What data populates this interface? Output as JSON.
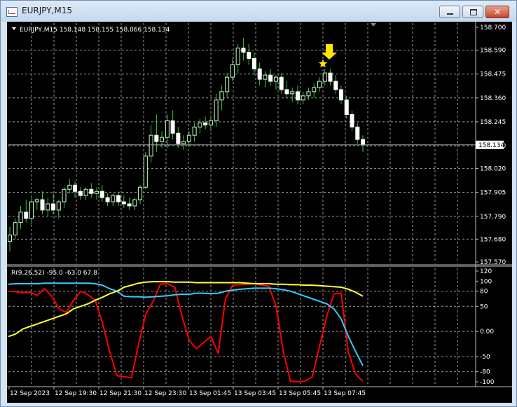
{
  "window": {
    "title": "EURJPY,M15",
    "controls": {
      "minimize": "minimize",
      "maximize": "maximize",
      "close": "close"
    }
  },
  "colors": {
    "background": "#000000",
    "grid": "#9a9a9a",
    "bull_candle": "#ccffcc",
    "bear_candle": "#ffffff",
    "wick": "#33cc33",
    "price_line": "#a0a0a0",
    "red_line": "#ff0000",
    "cyan_line": "#33ccff",
    "yellow_line": "#ffff33",
    "signal": "#ffe600"
  },
  "price_panel": {
    "header": "EURJPY,M15  158.148 158.155 158.066 158.134",
    "current_price": "158.134",
    "y_ticks": [
      "158.700",
      "158.590",
      "158.475",
      "158.360",
      "158.245",
      "158.130",
      "158.020",
      "157.905",
      "157.790",
      "157.680",
      "157.570"
    ],
    "ylim": [
      157.57,
      158.7
    ]
  },
  "indicator_panel": {
    "header": "R(9,26,52) -95.0 -63.0 67.8",
    "y_ticks": [
      "120",
      "100",
      "80",
      "50",
      "0.00",
      "-50",
      "-80",
      "-100"
    ],
    "ylim": [
      -100,
      120
    ]
  },
  "x_axis": {
    "labels": [
      "12 Sep 2023",
      "12 Sep 19:30",
      "12 Sep 21:30",
      "12 Sep 23:30",
      "13 Sep 01:45",
      "13 Sep 03:45",
      "13 Sep 05:45",
      "13 Sep 07:45"
    ]
  },
  "chart_data": [
    {
      "type": "candlestick",
      "symbol": "EURJPY",
      "timeframe": "M15",
      "ohlc_open_high_low_close": [
        [
          157.67,
          157.74,
          157.62,
          157.7
        ],
        [
          157.7,
          157.78,
          157.68,
          157.76
        ],
        [
          157.76,
          157.84,
          157.73,
          157.81
        ],
        [
          157.81,
          157.87,
          157.76,
          157.78
        ],
        [
          157.78,
          157.88,
          157.75,
          157.86
        ],
        [
          157.86,
          157.88,
          157.82,
          157.87
        ],
        [
          157.87,
          157.91,
          157.8,
          157.82
        ],
        [
          157.82,
          157.88,
          157.79,
          157.85
        ],
        [
          157.85,
          157.9,
          157.8,
          157.82
        ],
        [
          157.82,
          157.87,
          157.78,
          157.86
        ],
        [
          157.86,
          157.93,
          157.83,
          157.92
        ],
        [
          157.92,
          157.97,
          157.9,
          157.94
        ],
        [
          157.94,
          157.96,
          157.88,
          157.91
        ],
        [
          157.91,
          157.93,
          157.87,
          157.89
        ],
        [
          157.89,
          157.93,
          157.87,
          157.92
        ],
        [
          157.92,
          157.95,
          157.88,
          157.9
        ],
        [
          157.9,
          157.93,
          157.87,
          157.91
        ],
        [
          157.91,
          157.94,
          157.86,
          157.88
        ],
        [
          157.88,
          157.9,
          157.84,
          157.86
        ],
        [
          157.86,
          157.9,
          157.84,
          157.89
        ],
        [
          157.89,
          157.91,
          157.84,
          157.86
        ],
        [
          157.86,
          157.89,
          157.83,
          157.85
        ],
        [
          157.85,
          157.88,
          157.82,
          157.84
        ],
        [
          157.84,
          157.88,
          157.82,
          157.87
        ],
        [
          157.87,
          157.94,
          157.85,
          157.93
        ],
        [
          157.93,
          158.1,
          157.92,
          158.08
        ],
        [
          158.08,
          158.23,
          158.05,
          158.18
        ],
        [
          158.18,
          158.28,
          158.1,
          158.15
        ],
        [
          158.15,
          158.2,
          158.12,
          158.17
        ],
        [
          158.17,
          158.28,
          158.12,
          158.25
        ],
        [
          158.25,
          158.3,
          158.16,
          158.19
        ],
        [
          158.19,
          158.22,
          158.12,
          158.14
        ],
        [
          158.14,
          158.18,
          158.11,
          158.15
        ],
        [
          158.15,
          158.2,
          158.13,
          158.18
        ],
        [
          158.18,
          158.24,
          158.15,
          158.22
        ],
        [
          158.22,
          158.26,
          158.19,
          158.24
        ],
        [
          158.24,
          158.27,
          158.21,
          158.23
        ],
        [
          158.23,
          158.27,
          158.2,
          158.25
        ],
        [
          158.25,
          158.38,
          158.22,
          158.35
        ],
        [
          158.35,
          158.42,
          158.3,
          158.39
        ],
        [
          158.39,
          158.48,
          158.36,
          158.46
        ],
        [
          158.46,
          158.55,
          158.44,
          158.52
        ],
        [
          158.52,
          158.62,
          158.48,
          158.6
        ],
        [
          158.6,
          158.65,
          158.54,
          158.58
        ],
        [
          158.58,
          158.62,
          158.52,
          158.55
        ],
        [
          158.55,
          158.58,
          158.47,
          158.5
        ],
        [
          158.5,
          158.53,
          158.42,
          158.45
        ],
        [
          158.45,
          158.49,
          158.41,
          158.47
        ],
        [
          158.47,
          158.5,
          158.42,
          158.44
        ],
        [
          158.44,
          158.47,
          158.4,
          158.46
        ],
        [
          158.46,
          158.48,
          158.38,
          158.4
        ],
        [
          158.4,
          158.44,
          158.36,
          158.38
        ],
        [
          158.38,
          158.41,
          158.34,
          158.39
        ],
        [
          158.39,
          158.42,
          158.33,
          158.35
        ],
        [
          158.35,
          158.39,
          158.33,
          158.37
        ],
        [
          158.37,
          158.41,
          158.35,
          158.39
        ],
        [
          158.39,
          158.43,
          158.36,
          158.41
        ],
        [
          158.41,
          158.46,
          158.39,
          158.44
        ],
        [
          158.44,
          158.5,
          158.42,
          158.48
        ],
        [
          158.48,
          158.5,
          158.42,
          158.44
        ],
        [
          158.44,
          158.47,
          158.38,
          158.4
        ],
        [
          158.4,
          158.42,
          158.33,
          158.35
        ],
        [
          158.35,
          158.37,
          158.26,
          158.28
        ],
        [
          158.28,
          158.3,
          158.2,
          158.22
        ],
        [
          158.22,
          158.24,
          158.14,
          158.16
        ],
        [
          158.16,
          158.18,
          158.1,
          158.134
        ]
      ],
      "last": 158.134
    },
    {
      "type": "line",
      "name": "R(9,26,52)",
      "ylim": [
        -100,
        120
      ],
      "series": [
        {
          "color": "#ff0000",
          "values": [
            80,
            79,
            77,
            78,
            72,
            85,
            70,
            45,
            38,
            62,
            80,
            73,
            62,
            17,
            -40,
            -88,
            -90,
            -92,
            -25,
            35,
            60,
            94,
            95,
            88,
            30,
            -18,
            -34,
            -22,
            -10,
            -44,
            65,
            92,
            93,
            94,
            95,
            92,
            90,
            50,
            -40,
            -99,
            -100,
            -99,
            -90,
            -30,
            30,
            75,
            76,
            -42,
            -85,
            -99
          ]
        },
        {
          "color": "#33ccff",
          "values": [
            94,
            95,
            95,
            95,
            95,
            96,
            96,
            96,
            96,
            96,
            96,
            96,
            95,
            92,
            85,
            80,
            70,
            69,
            69,
            68,
            69,
            70,
            71,
            73,
            74,
            74,
            76,
            76,
            75,
            76,
            80,
            82,
            84,
            85,
            86,
            86,
            86,
            85,
            83,
            80,
            75,
            70,
            65,
            60,
            55,
            45,
            25,
            -10,
            -40,
            -68
          ]
        },
        {
          "color": "#ffff33",
          "values": [
            -10,
            -5,
            5,
            10,
            15,
            20,
            25,
            30,
            35,
            45,
            50,
            55,
            62,
            68,
            75,
            80,
            88,
            92,
            96,
            98,
            99,
            99,
            99,
            98,
            98,
            98,
            97,
            97,
            97,
            97,
            97,
            97,
            97,
            96,
            95,
            95,
            95,
            94,
            94,
            93,
            93,
            92,
            92,
            91,
            90,
            89,
            88,
            84,
            78,
            70
          ]
        }
      ]
    }
  ]
}
